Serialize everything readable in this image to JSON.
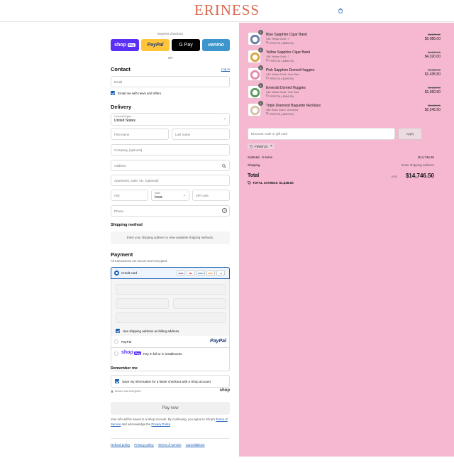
{
  "header": {
    "logo": "ERINESS",
    "cart_icon": "shopping-bag-icon"
  },
  "express": {
    "label": "Express checkout",
    "shop_pay": "shop",
    "shop_pay_badge": "Pay",
    "paypal": "PayPal",
    "gpay": "G Pay",
    "venmo": "venmo",
    "or": "OR"
  },
  "contact": {
    "title": "Contact",
    "login": "Log in",
    "email_placeholder": "Email",
    "newsletter_label": "Email me with news and offers"
  },
  "delivery": {
    "title": "Delivery",
    "country_label": "Country/Region",
    "country_value": "United States",
    "first_name": "First name",
    "last_name": "Last name",
    "company": "Company (optional)",
    "address": "Address",
    "apartment": "Apartment, suite, etc. (optional)",
    "city": "City",
    "state_label": "State",
    "state_value": "Iowa",
    "zip": "ZIP code",
    "phone": "Phone"
  },
  "shipping_method": {
    "title": "Shipping method",
    "notice": "Enter your shipping address to view available shipping methods."
  },
  "payment": {
    "title": "Payment",
    "subtitle": "All transactions are secure and encrypted.",
    "credit_card": "Credit card",
    "card_brands": [
      "VISA",
      "MC",
      "AMEX",
      "DISC",
      "+4"
    ],
    "billing_same": "Use shipping address as billing address",
    "paypal_label": "PayPal",
    "paypal_logo": "PayPal",
    "shoppay_logo": "shop",
    "shoppay_badge": "Pay",
    "shoppay_text": "Pay in full or in installments"
  },
  "remember": {
    "title": "Remember me",
    "save_label": "Save my information for a faster checkout with a Shop account",
    "secure": "Secure and encrypted",
    "shop_brand": "shop"
  },
  "pay_now": "Pay now",
  "legal": {
    "text1": "Your info will be saved to a Shop account. By continuing, you agree to Shop's",
    "terms": "Terms of Service",
    "text2": "and acknowledge the",
    "privacy": "Privacy Policy",
    "text3": "."
  },
  "footer_links": [
    "Refund policy",
    "Privacy policy",
    "Terms of service",
    "Cancellations"
  ],
  "cart": {
    "items": [
      {
        "qty": "1",
        "name": "Blue Sapphire Cigar Band",
        "variant": "14K Yellow Gold / 7",
        "discount": "FIRST10 (-$565.00)",
        "old_price": "$5,650.00",
        "price": "$5,085.00",
        "color": "#6b7fa8"
      },
      {
        "qty": "1",
        "name": "Yellow Sapphire Cigar Band",
        "variant": "14K Yellow Gold / 7",
        "discount": "FIRST10 (-$480.00)",
        "old_price": "$4,800.00",
        "price": "$4,320.00",
        "color": "#d9a441"
      },
      {
        "qty": "1",
        "name": "Pink Sapphire Domed Huggies",
        "variant": "14K Yellow Gold / One Size",
        "discount": "FIRST10 (-$159.50)",
        "old_price": "$1,595.00",
        "price": "$1,435.50",
        "color": "#e58aa8"
      },
      {
        "qty": "1",
        "name": "Emerald Domed Huggies",
        "variant": "14K Yellow Gold / One Size",
        "discount": "FIRST10 (-$184.50)",
        "old_price": "$1,845.00",
        "price": "$1,660.50",
        "color": "#5e9a5e"
      },
      {
        "qty": "1",
        "name": "Triple Diamond Baguette Necklace",
        "variant": "18K Rose Gold / 16 Inches",
        "discount": "FIRST10 (-$249.50)",
        "old_price": "$2,495.00",
        "price": "$2,245.50",
        "color": "#d8c0a8"
      }
    ],
    "discount_placeholder": "Discount code or gift card",
    "apply": "Apply",
    "code_chip": "FIRST10",
    "subtotal_label": "Subtotal · 5 items",
    "subtotal_value": "$14,746.50",
    "shipping_label": "Shipping",
    "shipping_value": "Enter shipping address",
    "total_label": "Total",
    "currency": "USD",
    "total_value": "$14,746.50",
    "savings_label": "TOTAL SAVINGS",
    "savings_value": "$1,638.50"
  }
}
